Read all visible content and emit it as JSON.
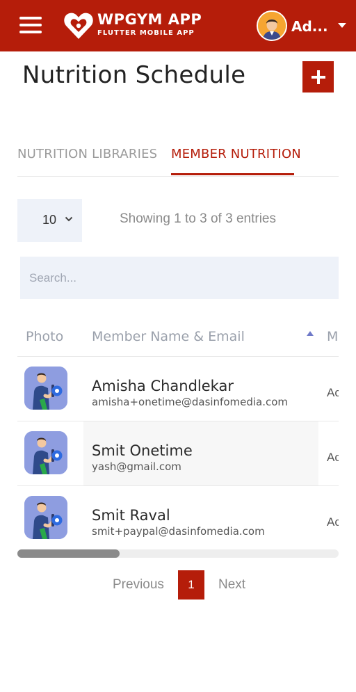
{
  "header": {
    "app_title": "WPGYM APP",
    "app_subtitle": "FLUTTER MOBILE APP",
    "user_name": "Ad...",
    "brand_color": "#b51d0a"
  },
  "page": {
    "title": "Nutrition Schedule"
  },
  "tabs": [
    {
      "label": "NUTRITION LIBRARIES",
      "active": false
    },
    {
      "label": "MEMBER NUTRITION",
      "active": true
    }
  ],
  "table_controls": {
    "page_size": "10",
    "info": "Showing 1 to 3 of 3 entries",
    "search_placeholder": "Search..."
  },
  "table": {
    "columns": [
      "Photo",
      "Member Name & Email",
      "M"
    ],
    "rows": [
      {
        "name": "Amisha Chandlekar",
        "email": "amisha+onetime@dasinfomedia.com",
        "more": "Ac"
      },
      {
        "name": "Smit Onetime",
        "email": "yash@gmail.com",
        "more": "Ac"
      },
      {
        "name": "Smit Raval",
        "email": "smit+paypal@dasinfomedia.com",
        "more": "Ac"
      }
    ]
  },
  "pagination": {
    "previous": "Previous",
    "current": "1",
    "next": "Next"
  }
}
